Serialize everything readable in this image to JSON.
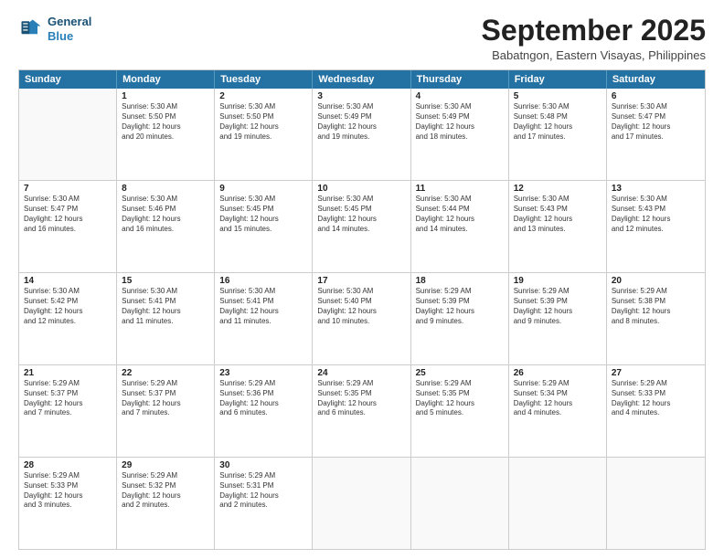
{
  "logo": {
    "line1": "General",
    "line2": "Blue"
  },
  "title": "September 2025",
  "subtitle": "Babatngon, Eastern Visayas, Philippines",
  "days": [
    "Sunday",
    "Monday",
    "Tuesday",
    "Wednesday",
    "Thursday",
    "Friday",
    "Saturday"
  ],
  "rows": [
    [
      {
        "day": "",
        "info": ""
      },
      {
        "day": "1",
        "info": "Sunrise: 5:30 AM\nSunset: 5:50 PM\nDaylight: 12 hours\nand 20 minutes."
      },
      {
        "day": "2",
        "info": "Sunrise: 5:30 AM\nSunset: 5:50 PM\nDaylight: 12 hours\nand 19 minutes."
      },
      {
        "day": "3",
        "info": "Sunrise: 5:30 AM\nSunset: 5:49 PM\nDaylight: 12 hours\nand 19 minutes."
      },
      {
        "day": "4",
        "info": "Sunrise: 5:30 AM\nSunset: 5:49 PM\nDaylight: 12 hours\nand 18 minutes."
      },
      {
        "day": "5",
        "info": "Sunrise: 5:30 AM\nSunset: 5:48 PM\nDaylight: 12 hours\nand 17 minutes."
      },
      {
        "day": "6",
        "info": "Sunrise: 5:30 AM\nSunset: 5:47 PM\nDaylight: 12 hours\nand 17 minutes."
      }
    ],
    [
      {
        "day": "7",
        "info": "Sunrise: 5:30 AM\nSunset: 5:47 PM\nDaylight: 12 hours\nand 16 minutes."
      },
      {
        "day": "8",
        "info": "Sunrise: 5:30 AM\nSunset: 5:46 PM\nDaylight: 12 hours\nand 16 minutes."
      },
      {
        "day": "9",
        "info": "Sunrise: 5:30 AM\nSunset: 5:45 PM\nDaylight: 12 hours\nand 15 minutes."
      },
      {
        "day": "10",
        "info": "Sunrise: 5:30 AM\nSunset: 5:45 PM\nDaylight: 12 hours\nand 14 minutes."
      },
      {
        "day": "11",
        "info": "Sunrise: 5:30 AM\nSunset: 5:44 PM\nDaylight: 12 hours\nand 14 minutes."
      },
      {
        "day": "12",
        "info": "Sunrise: 5:30 AM\nSunset: 5:43 PM\nDaylight: 12 hours\nand 13 minutes."
      },
      {
        "day": "13",
        "info": "Sunrise: 5:30 AM\nSunset: 5:43 PM\nDaylight: 12 hours\nand 12 minutes."
      }
    ],
    [
      {
        "day": "14",
        "info": "Sunrise: 5:30 AM\nSunset: 5:42 PM\nDaylight: 12 hours\nand 12 minutes."
      },
      {
        "day": "15",
        "info": "Sunrise: 5:30 AM\nSunset: 5:41 PM\nDaylight: 12 hours\nand 11 minutes."
      },
      {
        "day": "16",
        "info": "Sunrise: 5:30 AM\nSunset: 5:41 PM\nDaylight: 12 hours\nand 11 minutes."
      },
      {
        "day": "17",
        "info": "Sunrise: 5:30 AM\nSunset: 5:40 PM\nDaylight: 12 hours\nand 10 minutes."
      },
      {
        "day": "18",
        "info": "Sunrise: 5:29 AM\nSunset: 5:39 PM\nDaylight: 12 hours\nand 9 minutes."
      },
      {
        "day": "19",
        "info": "Sunrise: 5:29 AM\nSunset: 5:39 PM\nDaylight: 12 hours\nand 9 minutes."
      },
      {
        "day": "20",
        "info": "Sunrise: 5:29 AM\nSunset: 5:38 PM\nDaylight: 12 hours\nand 8 minutes."
      }
    ],
    [
      {
        "day": "21",
        "info": "Sunrise: 5:29 AM\nSunset: 5:37 PM\nDaylight: 12 hours\nand 7 minutes."
      },
      {
        "day": "22",
        "info": "Sunrise: 5:29 AM\nSunset: 5:37 PM\nDaylight: 12 hours\nand 7 minutes."
      },
      {
        "day": "23",
        "info": "Sunrise: 5:29 AM\nSunset: 5:36 PM\nDaylight: 12 hours\nand 6 minutes."
      },
      {
        "day": "24",
        "info": "Sunrise: 5:29 AM\nSunset: 5:35 PM\nDaylight: 12 hours\nand 6 minutes."
      },
      {
        "day": "25",
        "info": "Sunrise: 5:29 AM\nSunset: 5:35 PM\nDaylight: 12 hours\nand 5 minutes."
      },
      {
        "day": "26",
        "info": "Sunrise: 5:29 AM\nSunset: 5:34 PM\nDaylight: 12 hours\nand 4 minutes."
      },
      {
        "day": "27",
        "info": "Sunrise: 5:29 AM\nSunset: 5:33 PM\nDaylight: 12 hours\nand 4 minutes."
      }
    ],
    [
      {
        "day": "28",
        "info": "Sunrise: 5:29 AM\nSunset: 5:33 PM\nDaylight: 12 hours\nand 3 minutes."
      },
      {
        "day": "29",
        "info": "Sunrise: 5:29 AM\nSunset: 5:32 PM\nDaylight: 12 hours\nand 2 minutes."
      },
      {
        "day": "30",
        "info": "Sunrise: 5:29 AM\nSunset: 5:31 PM\nDaylight: 12 hours\nand 2 minutes."
      },
      {
        "day": "",
        "info": ""
      },
      {
        "day": "",
        "info": ""
      },
      {
        "day": "",
        "info": ""
      },
      {
        "day": "",
        "info": ""
      }
    ]
  ]
}
